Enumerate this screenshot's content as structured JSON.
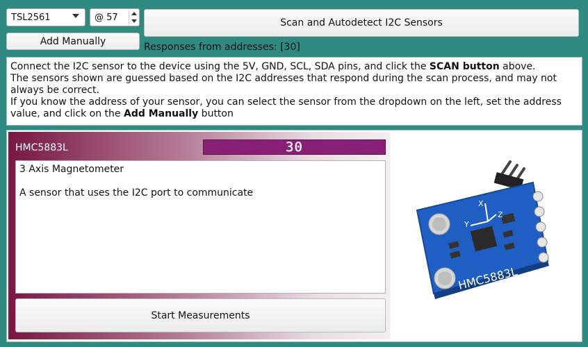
{
  "sensor_select": {
    "value": "TSL2561"
  },
  "address_input": {
    "value": "@ 57"
  },
  "buttons": {
    "scan": "Scan and Autodetect I2C Sensors",
    "add_manually": "Add Manually",
    "start": "Start Measurements"
  },
  "responses_text": "Responses from addresses: [30]",
  "info": {
    "line1_pre": "Connect the I2C sensor to the device using the 5V, GND, SCL, SDA pins, and click the ",
    "line1_bold": "SCAN button",
    "line1_post": " above.",
    "line2": "The sensors shown are guessed based on the I2C addresses that respond during the scan process, and may not always be correct.",
    "line3_pre": "If you know the address of your sensor, you can select the sensor from the dropdown on the left, set the address value, and click on the ",
    "line3_bold": "Add Manually",
    "line3_post": " button"
  },
  "sensor_card": {
    "name": "HMC5883L",
    "address_display": "30",
    "description_title": "3 Axis Magnetometer",
    "description_body": "A sensor that uses the I2C port to communicate",
    "board_label": "HMC5883L",
    "axis_labels": [
      "X",
      "Y",
      "Z"
    ]
  },
  "colors": {
    "background": "#2f8a82",
    "card_accent": "#7a1846",
    "address_display_bg": "#8a1f78",
    "board_blue": "#1f5fc4"
  }
}
